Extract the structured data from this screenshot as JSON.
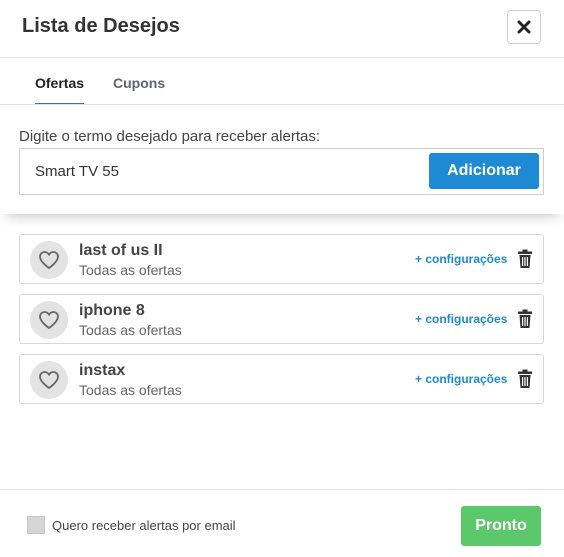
{
  "dialog": {
    "title": "Lista de Desejos",
    "close_icon": "close-icon"
  },
  "tabs": [
    {
      "label": "Ofertas",
      "active": true
    },
    {
      "label": "Cupons",
      "active": false
    }
  ],
  "search": {
    "label": "Digite o termo desejado para receber alertas:",
    "value": "Smart TV 55",
    "button_label": "Adicionar"
  },
  "items": [
    {
      "name": "last of us II",
      "subtitle": "Todas as ofertas",
      "config_label": "+ configurações",
      "icon": "heart-icon",
      "delete_icon": "trash-icon"
    },
    {
      "name": "iphone 8",
      "subtitle": "Todas as ofertas",
      "config_label": "+ configurações",
      "icon": "heart-icon",
      "delete_icon": "trash-icon"
    },
    {
      "name": "instax",
      "subtitle": "Todas as ofertas",
      "config_label": "+ configurações",
      "icon": "heart-icon",
      "delete_icon": "trash-icon"
    }
  ],
  "footer": {
    "checkbox_label": "Quero receber alertas por email",
    "checkbox_checked": false,
    "done_label": "Pronto"
  },
  "colors": {
    "accent": "#1e8ad4",
    "done": "#5cc86c",
    "heart_bg": "#e3e3e3"
  }
}
